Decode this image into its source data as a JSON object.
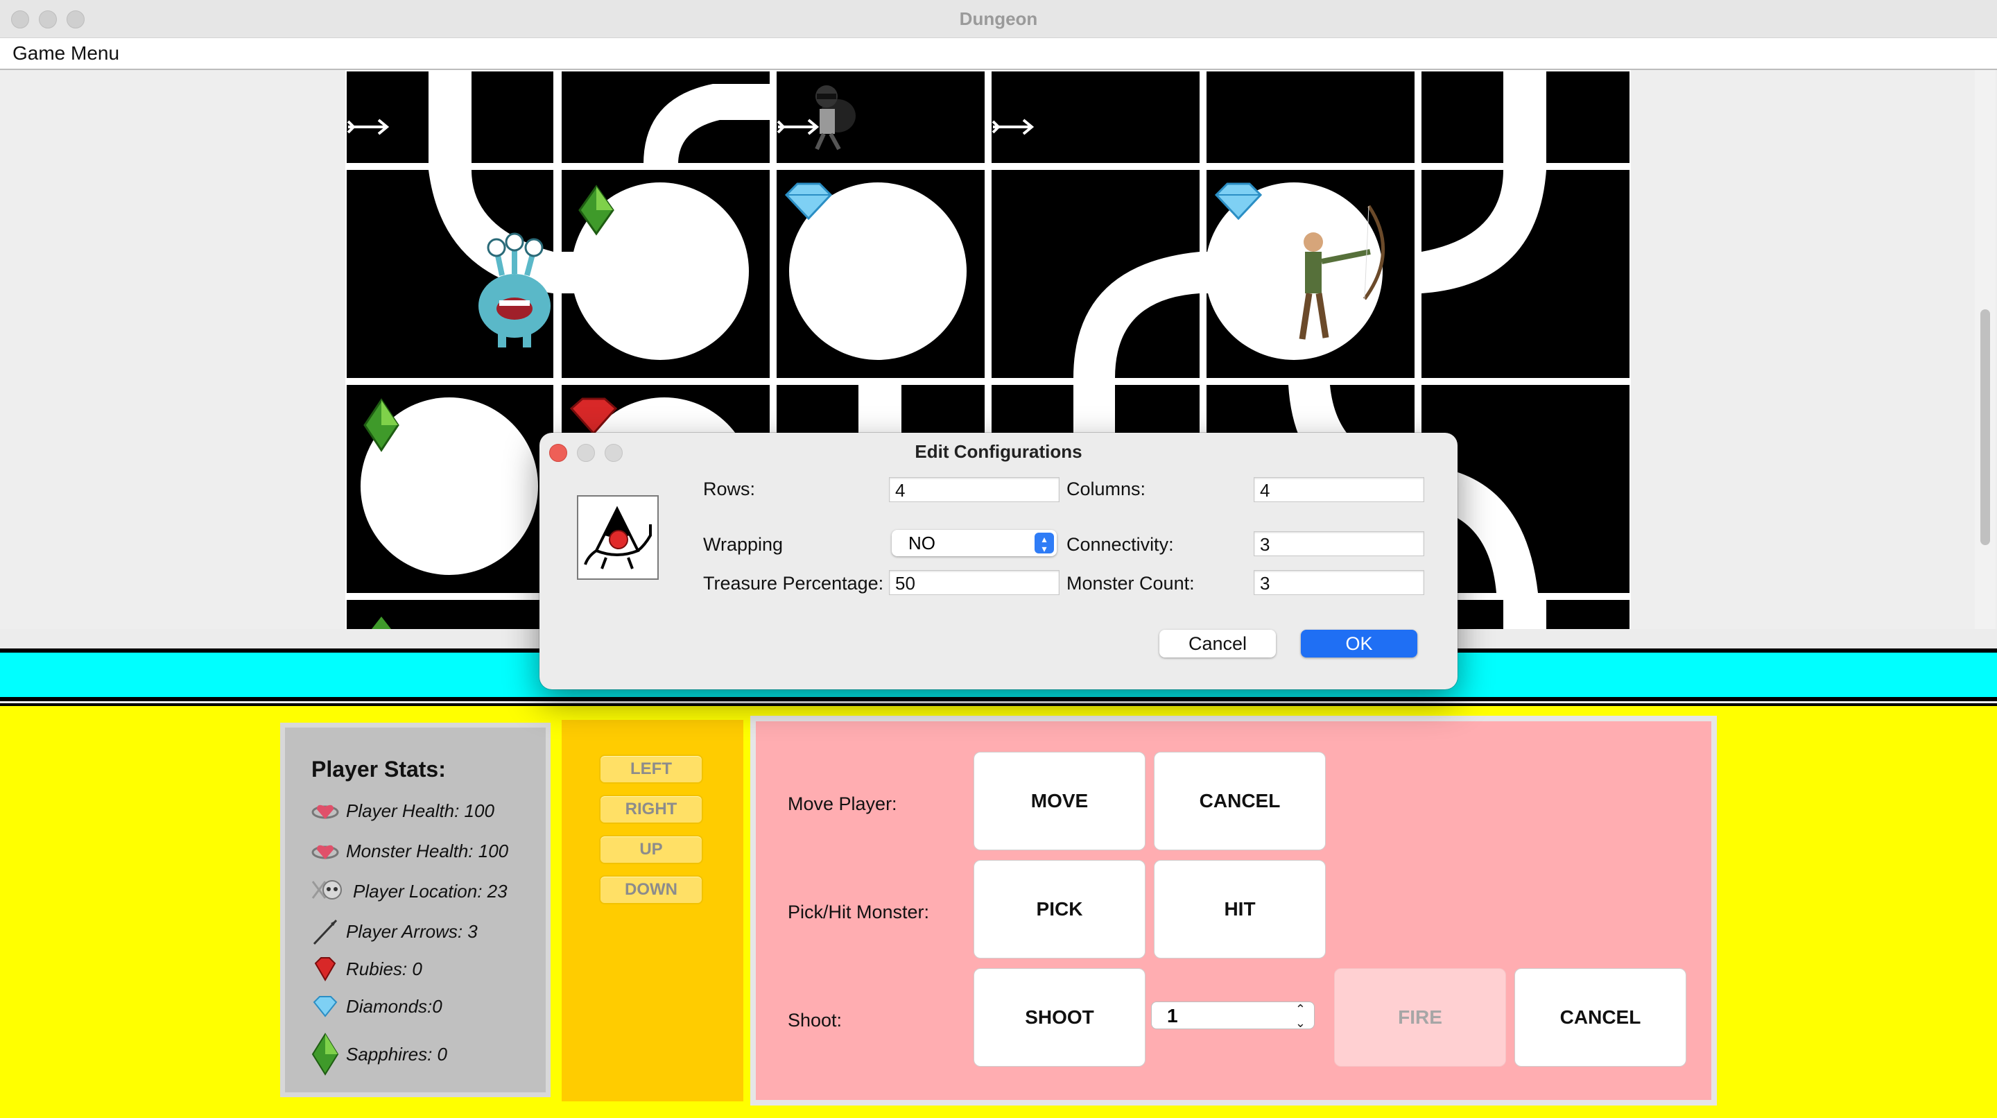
{
  "window": {
    "title": "Dungeon"
  },
  "menu": {
    "game_menu": "Game Menu"
  },
  "dialog": {
    "title": "Edit Configurations",
    "rows_label": "Rows:",
    "rows_value": "4",
    "columns_label": "Columns:",
    "columns_value": "4",
    "wrapping_label": "Wrapping",
    "wrapping_value": "NO",
    "connectivity_label": "Connectivity:",
    "connectivity_value": "3",
    "treasure_label": "Treasure Percentage:",
    "treasure_value": "50",
    "monster_count_label": "Monster Count:",
    "monster_count_value": "3",
    "cancel_label": "Cancel",
    "ok_label": "OK"
  },
  "stats": {
    "title": "Player Stats:",
    "items": [
      {
        "icon": "heart-icon",
        "label": "Player Health: 100"
      },
      {
        "icon": "heart-icon",
        "label": "Monster Health: 100"
      },
      {
        "icon": "skull-icon",
        "label": "Player Location: 23"
      },
      {
        "icon": "arrow-icon",
        "label": "Player Arrows: 3"
      },
      {
        "icon": "ruby-icon",
        "label": "Rubies: 0"
      },
      {
        "icon": "diamond-icon",
        "label": "Diamonds:0"
      },
      {
        "icon": "sapphire-icon",
        "label": "Sapphires: 0"
      }
    ]
  },
  "directions": {
    "left": "LEFT",
    "right": "RIGHT",
    "up": "UP",
    "down": "DOWN"
  },
  "actions": {
    "move_label": "Move Player:",
    "move_btn": "MOVE",
    "move_cancel": "CANCEL",
    "pick_label": "Pick/Hit Monster:",
    "pick_btn": "PICK",
    "hit_btn": "HIT",
    "shoot_label": "Shoot:",
    "shoot_btn": "SHOOT",
    "shoot_distance": "1",
    "fire_btn": "FIRE",
    "shoot_cancel": "CANCEL"
  },
  "colors": {
    "cyan_bar": "#00ffff",
    "control_bg": "#ffff00",
    "direction_panel": "#ffcc00",
    "action_panel": "#ffadb1",
    "stats_panel": "#c0c0c0",
    "ok_button": "#1f6ff4"
  }
}
